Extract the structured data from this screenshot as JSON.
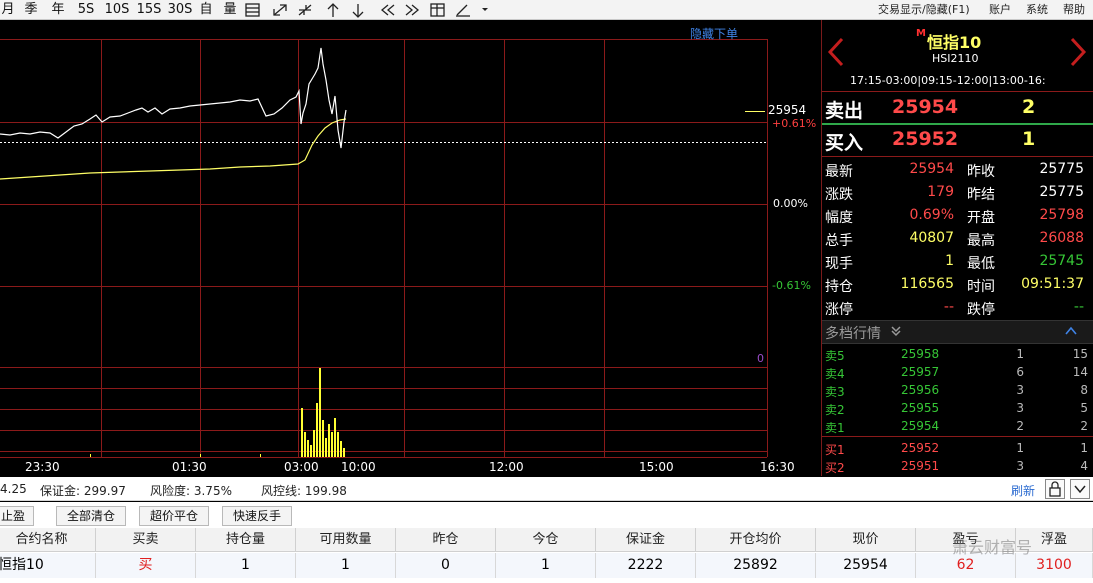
{
  "toolbar": {
    "periods": [
      "月",
      "季",
      "年",
      "5S",
      "10S",
      "15S",
      "30S"
    ],
    "buttons": [
      "自",
      "量"
    ],
    "right_menu": [
      "交易显示/隐藏(F1)",
      "账户",
      "系统",
      "帮助"
    ],
    "icons": [
      "ladder-icon",
      "expand-icon",
      "shrink-icon",
      "up-arrow-icon",
      "down-arrow-icon",
      "double-left-icon",
      "double-right-icon",
      "table-icon",
      "draw-icon",
      "dropdown-icon"
    ]
  },
  "chart": {
    "hide_orders": "隐藏下单",
    "current_price": "25954",
    "pct_labels": {
      "up": "+0.61%",
      "zero": "0.00%",
      "down": "-0.61%"
    },
    "volume_axis": "0",
    "time_labels": [
      "23:30",
      "01:30",
      "03:00",
      "10:00",
      "12:00",
      "15:00",
      "16:30"
    ],
    "colors": {
      "up": "#ff4040",
      "down": "#36c636",
      "price_line": "#ffffff",
      "avg_line": "#ffff66",
      "grid": "#8b1a1a"
    }
  },
  "quote": {
    "market_badge": "M",
    "name": "恒指10",
    "code": "HSI2110",
    "sessions": "17:15-03:00|09:15-12:00|13:00-16:",
    "sell": {
      "label": "卖出",
      "price": "25954",
      "qty": "2"
    },
    "buy": {
      "label": "买入",
      "price": "25952",
      "qty": "1"
    },
    "stats_left": [
      {
        "label": "最新",
        "value": "25954"
      },
      {
        "label": "涨跌",
        "value": "179"
      },
      {
        "label": "幅度",
        "value": "0.69%"
      },
      {
        "label": "总手",
        "value": "40807"
      },
      {
        "label": "现手",
        "value": "1"
      },
      {
        "label": "持仓",
        "value": "116565"
      },
      {
        "label": "涨停",
        "value": "--"
      }
    ],
    "stats_right": [
      {
        "label": "昨收",
        "value": "25775"
      },
      {
        "label": "昨结",
        "value": "25775"
      },
      {
        "label": "开盘",
        "value": "25798"
      },
      {
        "label": "最高",
        "value": "26088"
      },
      {
        "label": "最低",
        "value": "25745"
      },
      {
        "label": "时间",
        "value": "09:51:37"
      },
      {
        "label": "跌停",
        "value": "--"
      }
    ],
    "depth_title": "多档行情",
    "depth": [
      {
        "side": "卖5",
        "price": "25958",
        "mine": "1",
        "qty": "15"
      },
      {
        "side": "卖4",
        "price": "25957",
        "mine": "6",
        "qty": "14"
      },
      {
        "side": "卖3",
        "price": "25956",
        "mine": "3",
        "qty": "8"
      },
      {
        "side": "卖2",
        "price": "25955",
        "mine": "3",
        "qty": "5"
      },
      {
        "side": "卖1",
        "price": "25954",
        "mine": "2",
        "qty": "2"
      },
      {
        "side": "买1",
        "price": "25952",
        "mine": "1",
        "qty": "1"
      },
      {
        "side": "买2",
        "price": "25951",
        "mine": "3",
        "qty": "4"
      }
    ]
  },
  "status": {
    "left_fragment": "4.25",
    "margin": "保证金: 299.97",
    "risk": "风险度: 3.75%",
    "risk_line": "风控线: 199.98",
    "refresh": "刷新"
  },
  "actions": [
    "止盈",
    "全部清仓",
    "超价平仓",
    "快速反手"
  ],
  "table": {
    "headers": [
      "合约名称",
      "买卖",
      "持仓量",
      "可用数量",
      "昨仓",
      "今仓",
      "保证金",
      "开仓均价",
      "现价",
      "盈亏",
      "浮盈"
    ],
    "rows": [
      [
        "恒指10",
        "买",
        "1",
        "1",
        "0",
        "1",
        "2222",
        "25892",
        "25954",
        "62",
        "3100"
      ]
    ]
  },
  "watermark": "萧云财富号"
}
